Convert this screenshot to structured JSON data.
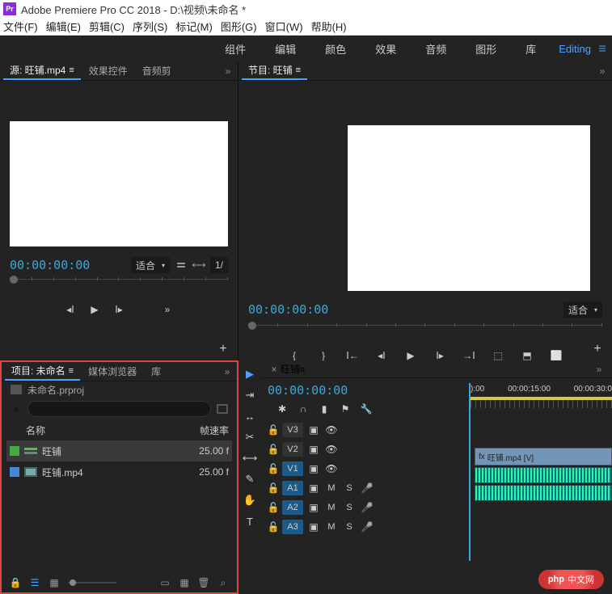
{
  "window": {
    "title": "Adobe Premiere Pro CC 2018 - D:\\视频\\未命名 *",
    "app_abbrev": "Pr"
  },
  "menu": [
    "文件(F)",
    "编辑(E)",
    "剪辑(C)",
    "序列(S)",
    "标记(M)",
    "图形(G)",
    "窗口(W)",
    "帮助(H)"
  ],
  "tabs": {
    "items": [
      "组件",
      "编辑",
      "颜色",
      "效果",
      "音频",
      "图形",
      "库"
    ],
    "workspace": "Editing"
  },
  "source": {
    "tabs": [
      "源: 旺铺.mp4",
      "效果控件",
      "音频剪"
    ],
    "timecode": "00:00:00:00",
    "fit_label": "适合",
    "half_label": "1/"
  },
  "program": {
    "title": "节目: 旺铺",
    "timecode": "00:00:00:00",
    "fit_label": "适合"
  },
  "project": {
    "tabs": [
      "项目: 未命名",
      "媒体浏览器",
      "库"
    ],
    "filename": "未命名.prproj",
    "cols": {
      "name": "名称",
      "rate": "帧速率"
    },
    "items": [
      {
        "name": "旺铺",
        "rate": "25.00 f",
        "swatch": "green",
        "type": "sequence"
      },
      {
        "name": "旺铺.mp4",
        "rate": "25.00 f",
        "swatch": "blue",
        "type": "video"
      }
    ]
  },
  "timeline": {
    "tab": "旺铺",
    "timecode": "00:00:00:00",
    "ruler": [
      "):00",
      "00:00:15:00",
      "00:00:30:0"
    ],
    "video_tracks": [
      "V3",
      "V2",
      "V1"
    ],
    "audio_tracks": [
      "A1",
      "A2",
      "A3"
    ],
    "clip_name": "旺铺.mp4 [V]"
  },
  "watermark": {
    "brand": "php",
    "text": "中文网"
  }
}
